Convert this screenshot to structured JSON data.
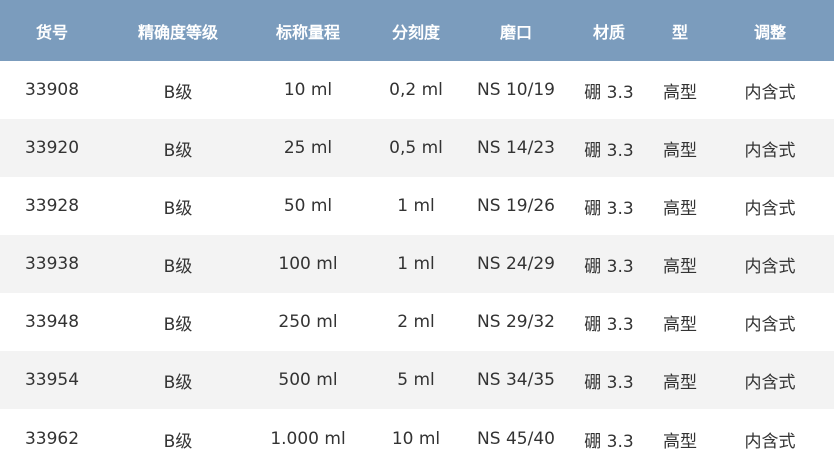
{
  "table": {
    "headers": [
      "货号",
      "精确度等级",
      "标称量程",
      "分刻度",
      "磨口",
      "材质",
      "型",
      "调整"
    ],
    "rows": [
      [
        "33908",
        "B级",
        "10 ml",
        "0,2 ml",
        "NS 10/19",
        "硼 3.3",
        "高型",
        "内含式"
      ],
      [
        "33920",
        "B级",
        "25 ml",
        "0,5 ml",
        "NS 14/23",
        "硼 3.3",
        "高型",
        "内含式"
      ],
      [
        "33928",
        "B级",
        "50 ml",
        "1 ml",
        "NS 19/26",
        "硼 3.3",
        "高型",
        "内含式"
      ],
      [
        "33938",
        "B级",
        "100 ml",
        "1 ml",
        "NS 24/29",
        "硼 3.3",
        "高型",
        "内含式"
      ],
      [
        "33948",
        "B级",
        "250 ml",
        "2 ml",
        "NS 29/32",
        "硼 3.3",
        "高型",
        "内含式"
      ],
      [
        "33954",
        "B级",
        "500 ml",
        "5 ml",
        "NS 34/35",
        "硼 3.3",
        "高型",
        "内含式"
      ],
      [
        "33962",
        "B级",
        "1.000 ml",
        "10 ml",
        "NS 45/40",
        "硼 3.3",
        "高型",
        "内含式"
      ]
    ]
  },
  "colors": {
    "header_bg": "#7b9cbd",
    "header_text": "#ffffff",
    "row_alt_bg": "#f3f3f3",
    "cell_text": "#333333"
  }
}
